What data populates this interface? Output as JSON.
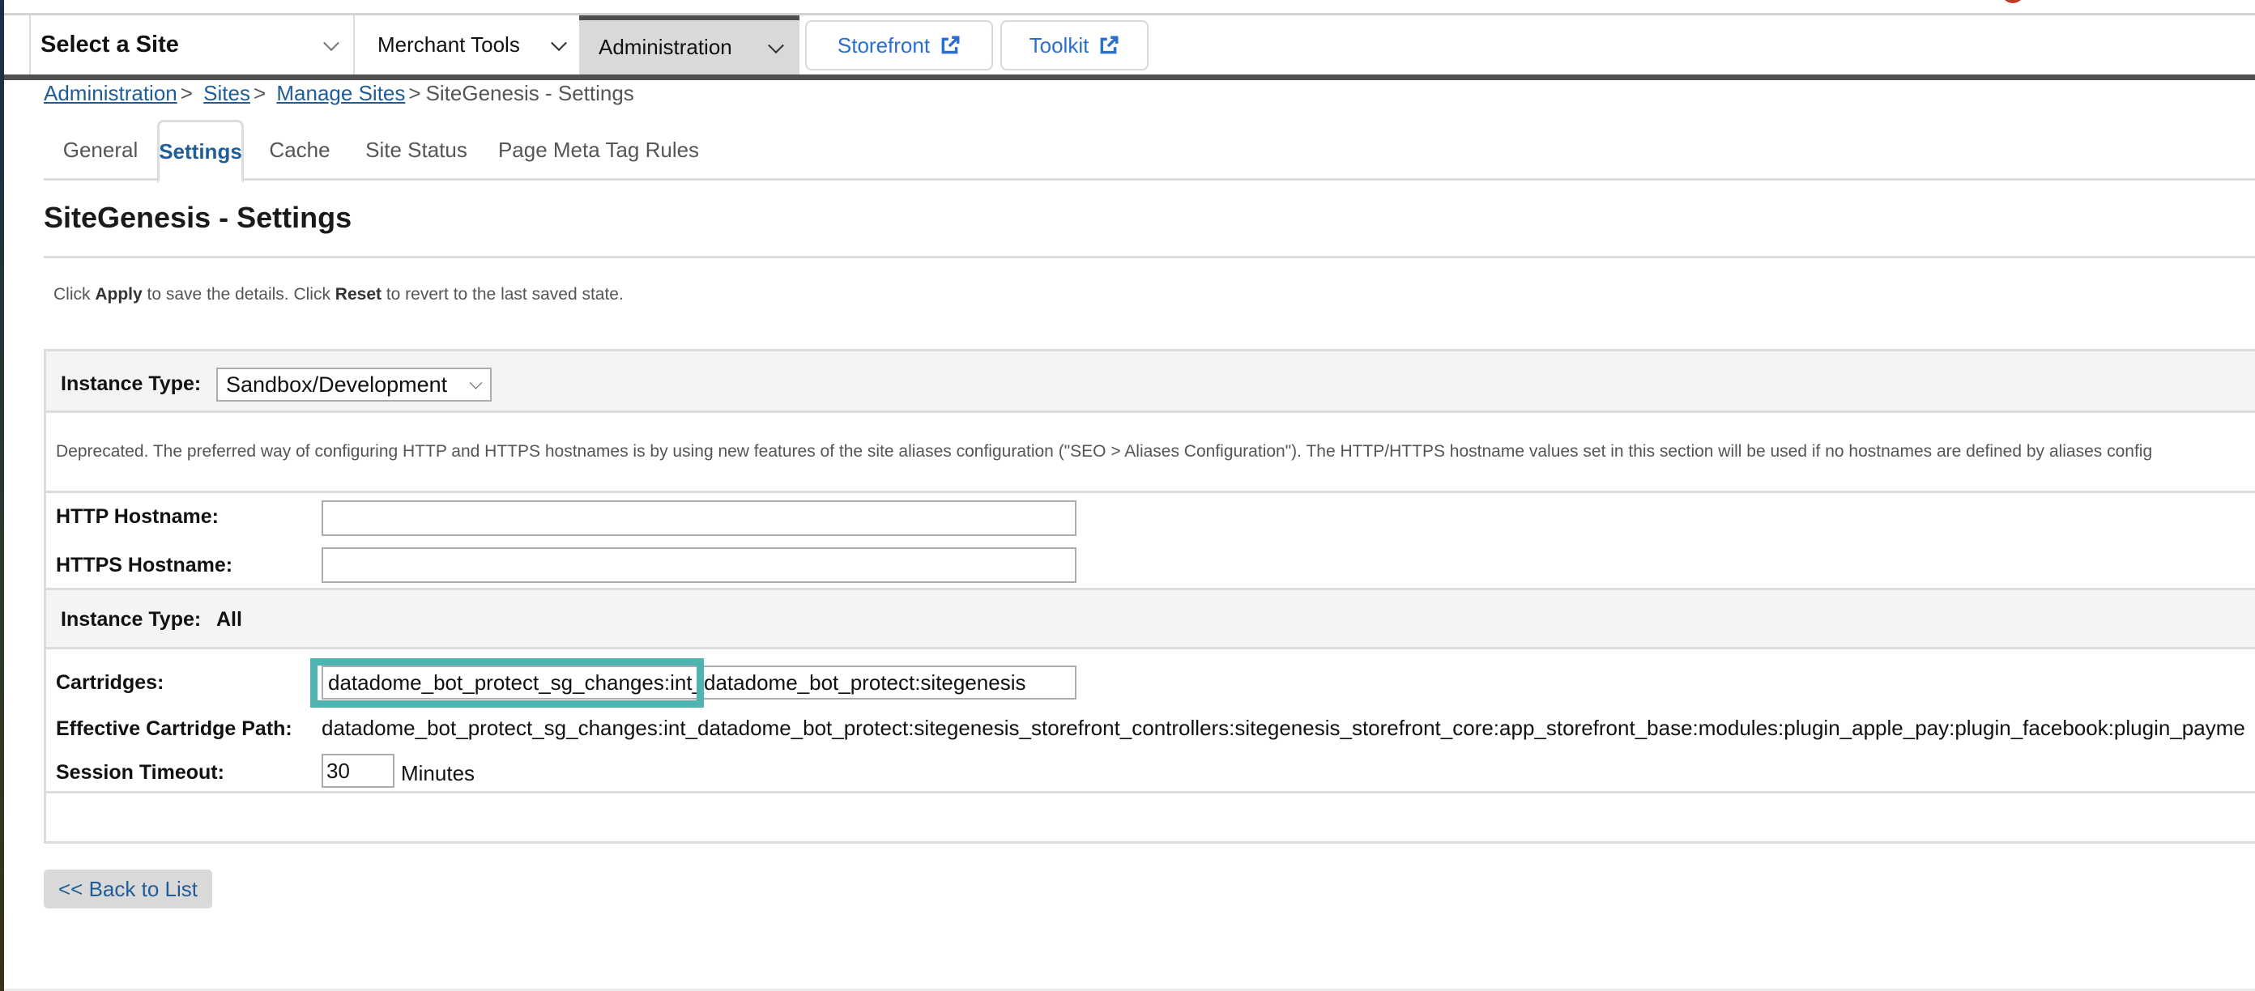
{
  "nav": {
    "site_selector": "Select a Site",
    "merchant_tools": "Merchant Tools",
    "administration": "Administration",
    "storefront": "Storefront",
    "toolkit": "Toolkit"
  },
  "breadcrumb": {
    "items": [
      "Administration",
      "Sites",
      "Manage Sites"
    ],
    "current": "SiteGenesis - Settings",
    "separator": ">"
  },
  "tabs": [
    {
      "label": "General",
      "active": false
    },
    {
      "label": "Settings",
      "active": true
    },
    {
      "label": "Cache",
      "active": false
    },
    {
      "label": "Site Status",
      "active": false
    },
    {
      "label": "Page Meta Tag Rules",
      "active": false
    }
  ],
  "page": {
    "title": "SiteGenesis - Settings",
    "instructions": {
      "part1": "Click ",
      "apply": "Apply",
      "part2": " to save the details. Click ",
      "reset": "Reset",
      "part3": " to revert to the last saved state."
    }
  },
  "form": {
    "instance_type_label": "Instance Type:",
    "instance_type_value": "Sandbox/Development",
    "deprecated_note": "Deprecated. The preferred way of configuring HTTP and HTTPS hostnames is by using new features of the site aliases configuration (\"SEO > Aliases Configuration\"). The HTTP/HTTPS hostname values set in this section will be used if no hostnames are defined by aliases config",
    "http_hostname_label": "HTTP Hostname:",
    "http_hostname_value": "",
    "https_hostname_label": "HTTPS Hostname:",
    "https_hostname_value": "",
    "instance_type_all_label": "Instance Type:",
    "instance_type_all_value": "All",
    "cartridges_label": "Cartridges:",
    "cartridges_value": "datadome_bot_protect_sg_changes:int_datadome_bot_protect:sitegenesis",
    "effective_path_label": "Effective Cartridge Path:",
    "effective_path_value": "datadome_bot_protect_sg_changes:int_datadome_bot_protect:sitegenesis_storefront_controllers:sitegenesis_storefront_core:app_storefront_base:modules:plugin_apple_pay:plugin_facebook:plugin_payme",
    "session_timeout_label": "Session Timeout:",
    "session_timeout_value": "30",
    "session_timeout_unit": "Minutes"
  },
  "actions": {
    "back_to_list": "<< Back to List"
  },
  "colors": {
    "link": "#1f5d99",
    "external_link": "#2a6fcf",
    "highlight": "#4fb3b2",
    "nav_bar": "#4f4f4f",
    "active_nav": "#d9d9d9"
  }
}
